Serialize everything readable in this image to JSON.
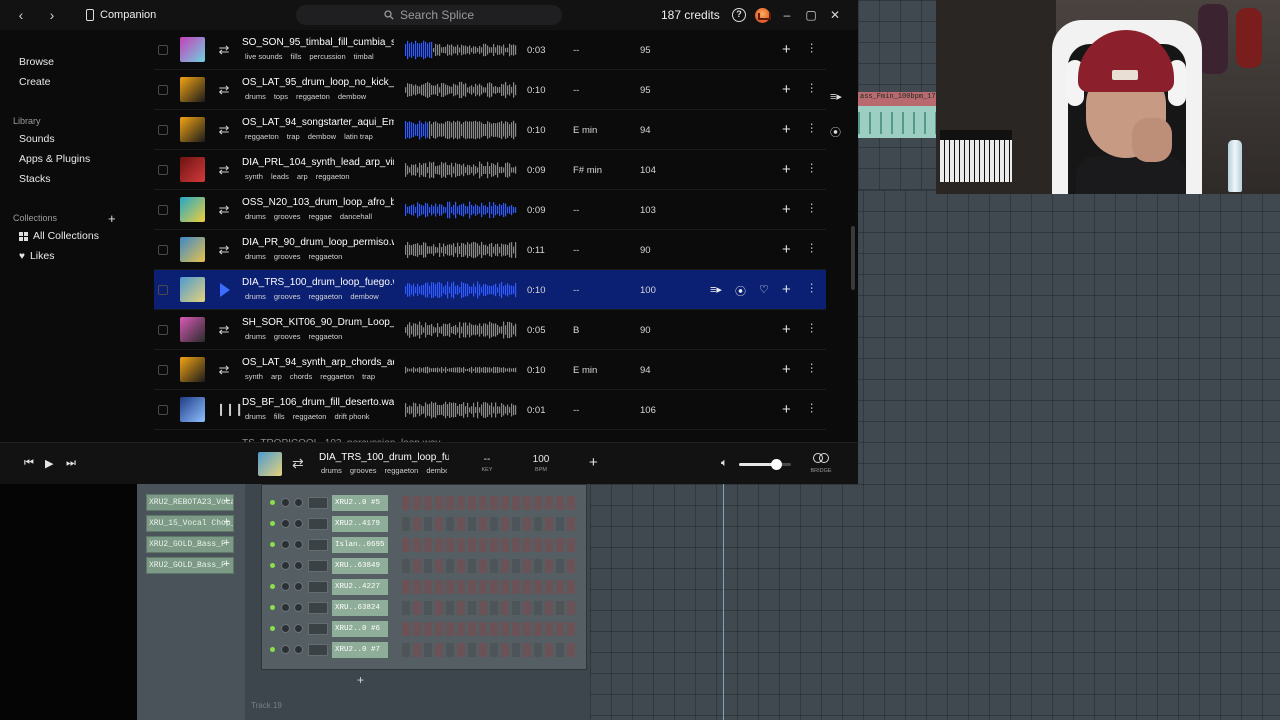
{
  "titlebar": {
    "app_label": "Companion",
    "search_placeholder": "Search Splice",
    "credits": "187 credits"
  },
  "sidebar": {
    "browse": "Browse",
    "create": "Create",
    "library_heading": "Library",
    "library_items": [
      "Sounds",
      "Apps & Plugins",
      "Stacks"
    ],
    "collections_heading": "Collections",
    "all_collections": "All Collections",
    "likes": "Likes"
  },
  "rows": [
    {
      "name": "SO_SON_95_timbal_fill_cumbia_solo.wav",
      "tags": [
        "live sounds",
        "fills",
        "percussion",
        "timbal"
      ],
      "duration": "0:03",
      "key": "--",
      "bpm": "95",
      "type": "loop",
      "art": [
        "#c63fb8",
        "#6fd1e0"
      ],
      "wave": "dense"
    },
    {
      "name": "OS_LAT_95_drum_loop_no_kick_fantasma.wav",
      "tags": [
        "drums",
        "tops",
        "reggaeton",
        "dembow"
      ],
      "duration": "0:10",
      "key": "--",
      "bpm": "95",
      "type": "loop",
      "art": [
        "#f2a414",
        "#1c1c1c"
      ],
      "wave": "medium"
    },
    {
      "name": "OS_LAT_94_songstarter_aqui_Em.wav",
      "tags": [
        "reggaeton",
        "trap",
        "dembow",
        "latin trap"
      ],
      "duration": "0:10",
      "key": "E min",
      "bpm": "94",
      "type": "loop",
      "art": [
        "#f2a414",
        "#1c1c1c"
      ],
      "wave": "full"
    },
    {
      "name": "DIA_PRL_104_synth_lead_arp_virtual.wav",
      "tags": [
        "synth",
        "leads",
        "arp",
        "reggaeton"
      ],
      "duration": "0:09",
      "key": "F# min",
      "bpm": "104",
      "type": "loop",
      "art": [
        "#6e1313",
        "#d33a3a"
      ],
      "wave": "medium"
    },
    {
      "name": "OSS_N20_103_drum_loop_afro_beat.wav",
      "tags": [
        "drums",
        "grooves",
        "reggae",
        "dancehall"
      ],
      "duration": "0:09",
      "key": "--",
      "bpm": "103",
      "type": "loop",
      "art": [
        "#22a7c9",
        "#f0cf3a"
      ],
      "wave": "blue"
    },
    {
      "name": "DIA_PR_90_drum_loop_permiso.wav",
      "tags": [
        "drums",
        "grooves",
        "reggaeton"
      ],
      "duration": "0:11",
      "key": "--",
      "bpm": "90",
      "type": "loop",
      "art": [
        "#3d87c9",
        "#e8c34a"
      ],
      "wave": "medium"
    },
    {
      "name": "DIA_TRS_100_drum_loop_fuego.wav",
      "tags": [
        "drums",
        "grooves",
        "reggaeton",
        "dembow"
      ],
      "duration": "0:10",
      "key": "--",
      "bpm": "100",
      "type": "play",
      "art": [
        "#4e9ad1",
        "#e5d27a"
      ],
      "wave": "selected"
    },
    {
      "name": "SH_SOR_KIT06_90_Drum_Loop_04.wav",
      "tags": [
        "drums",
        "grooves",
        "reggaeton"
      ],
      "duration": "0:05",
      "key": "B",
      "bpm": "90",
      "type": "loop",
      "art": [
        "#d85ab6",
        "#2b2b2b"
      ],
      "wave": "medium"
    },
    {
      "name": "OS_LAT_94_synth_arp_chords_aqui.wav",
      "tags": [
        "synth",
        "arp",
        "chords",
        "reggaeton",
        "trap"
      ],
      "duration": "0:10",
      "key": "E min",
      "bpm": "94",
      "type": "loop",
      "art": [
        "#f2a414",
        "#1c1c1c"
      ],
      "wave": "sparse"
    },
    {
      "name": "DS_BF_106_drum_fill_deserto.wav",
      "tags": [
        "drums",
        "fills",
        "reggaeton",
        "drift phonk"
      ],
      "duration": "0:01",
      "key": "--",
      "bpm": "106",
      "type": "oneshot",
      "art": [
        "#1f3c86",
        "#8fc0ff"
      ],
      "wave": "medium"
    }
  ],
  "partial_row_name": "TS_TROPICOOL_102_percussion_loop.wav",
  "player": {
    "name": "DIA_TRS_100_drum_loop_fuego.wav",
    "tags": [
      "drums",
      "grooves",
      "reggaeton",
      "dembow"
    ],
    "key": "--",
    "key_label": "KEY",
    "bpm": "100",
    "bpm_label": "BPM",
    "volume_fraction": 0.72,
    "bridge_label": "BRIDGE"
  },
  "fl": {
    "patterns": [
      "XRU2_REBOTA23_Vocal",
      "XRU_15_Vocal Chop_",
      "XRU2_GOLD_Bass_F",
      "XRU2_GOLD_Bass_F"
    ],
    "channels": [
      "XRU2..0 #5",
      "XRU2..4179",
      "Islan..0695",
      "XRU..63849",
      "XRU2..4227",
      "XRU..63824",
      "XRU2..0 #6",
      "XRU2..0 #7"
    ],
    "track_label": "Track 19",
    "clip_label": "ass_Fmin_100bpm_176"
  },
  "colors": {
    "accent": "#3b6cff",
    "selected_row": "#0b1f73",
    "waveform": "#8a8a8a",
    "waveform_active": "#2f5bff"
  }
}
